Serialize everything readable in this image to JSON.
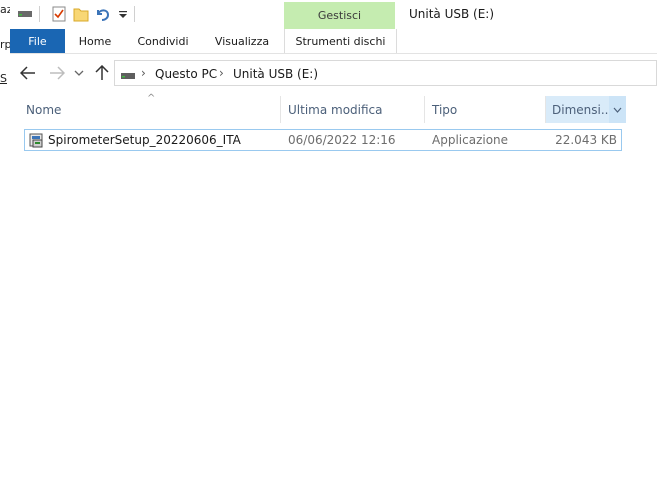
{
  "left_strip": {
    "chars": [
      "az",
      "rp",
      "S"
    ]
  },
  "quick_access": {
    "icons": [
      "drive-icon",
      "properties-check-icon",
      "new-folder-icon",
      "undo-icon",
      "customize-dropdown-icon"
    ]
  },
  "contextual_tab_group": {
    "label": "Gestisci"
  },
  "window": {
    "title": "Unità USB (E:)"
  },
  "ribbon": {
    "tabs": [
      {
        "label": "File"
      },
      {
        "label": "Home"
      },
      {
        "label": "Condividi"
      },
      {
        "label": "Visualizza"
      },
      {
        "label": "Strumenti dischi"
      }
    ]
  },
  "address_bar": {
    "crumbs": [
      "Questo PC",
      "Unità USB (E:)"
    ]
  },
  "columns": {
    "name": "Nome",
    "modified": "Ultima modifica",
    "type": "Tipo",
    "size": "Dimensi..."
  },
  "files": [
    {
      "name": "SpirometerSetup_20220606_ITA",
      "modified": "06/06/2022 12:16",
      "type": "Applicazione",
      "size": "22.043 KB"
    }
  ],
  "colors": {
    "file_tab": "#1a66b3",
    "contextual_tab": "#c5ecb0",
    "sorted_column": "#d9ebf9",
    "row_border": "#99c9ef"
  }
}
